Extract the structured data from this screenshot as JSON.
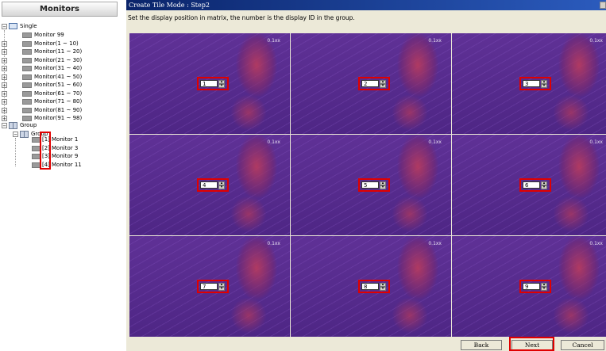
{
  "left_panel": {
    "header": "Monitors",
    "single": {
      "label": "Single",
      "items": [
        {
          "label": "Monitor 99",
          "expandable": false
        },
        {
          "label": "Monitor(1 ~ 10)",
          "expandable": true
        },
        {
          "label": "Monitor(11 ~ 20)",
          "expandable": true
        },
        {
          "label": "Monitor(21 ~ 30)",
          "expandable": true
        },
        {
          "label": "Monitor(31 ~ 40)",
          "expandable": true
        },
        {
          "label": "Monitor(41 ~ 50)",
          "expandable": true
        },
        {
          "label": "Monitor(51 ~ 60)",
          "expandable": true
        },
        {
          "label": "Monitor(61 ~ 70)",
          "expandable": true
        },
        {
          "label": "Monitor(71 ~ 80)",
          "expandable": true
        },
        {
          "label": "Monitor(81 ~ 90)",
          "expandable": true
        },
        {
          "label": "Monitor(91 ~ 98)",
          "expandable": true
        }
      ]
    },
    "group": {
      "label": "Group",
      "subgroup_label": "Group",
      "members": [
        {
          "index": "[1]",
          "label": "Monitor 1"
        },
        {
          "index": "[2]",
          "label": "Monitor 3"
        },
        {
          "index": "[3]",
          "label": "Monitor 9"
        },
        {
          "index": "[4]",
          "label": "Monitor 11"
        }
      ]
    }
  },
  "dialog": {
    "title": "Create Tile Mode : Step2",
    "instruction": "Set the display position in matrix, the number is the display ID in the group.",
    "cells": [
      {
        "value": "1",
        "badge": "0.1xx"
      },
      {
        "value": "2",
        "badge": "0.1xx"
      },
      {
        "value": "3",
        "badge": "0.1xx"
      },
      {
        "value": "4",
        "badge": "0.1xx"
      },
      {
        "value": "5",
        "badge": "0.1xx"
      },
      {
        "value": "6",
        "badge": "0.1xx"
      },
      {
        "value": "7",
        "badge": "0.1xx"
      },
      {
        "value": "8",
        "badge": "0.1xx"
      },
      {
        "value": "9",
        "badge": "0.1xx"
      }
    ],
    "buttons": {
      "back": "Back",
      "next": "Next",
      "cancel": "Cancel"
    }
  },
  "colors": {
    "highlight": "#e00000",
    "titlebar": "#0a246a",
    "tile": "#5a2d8c"
  }
}
